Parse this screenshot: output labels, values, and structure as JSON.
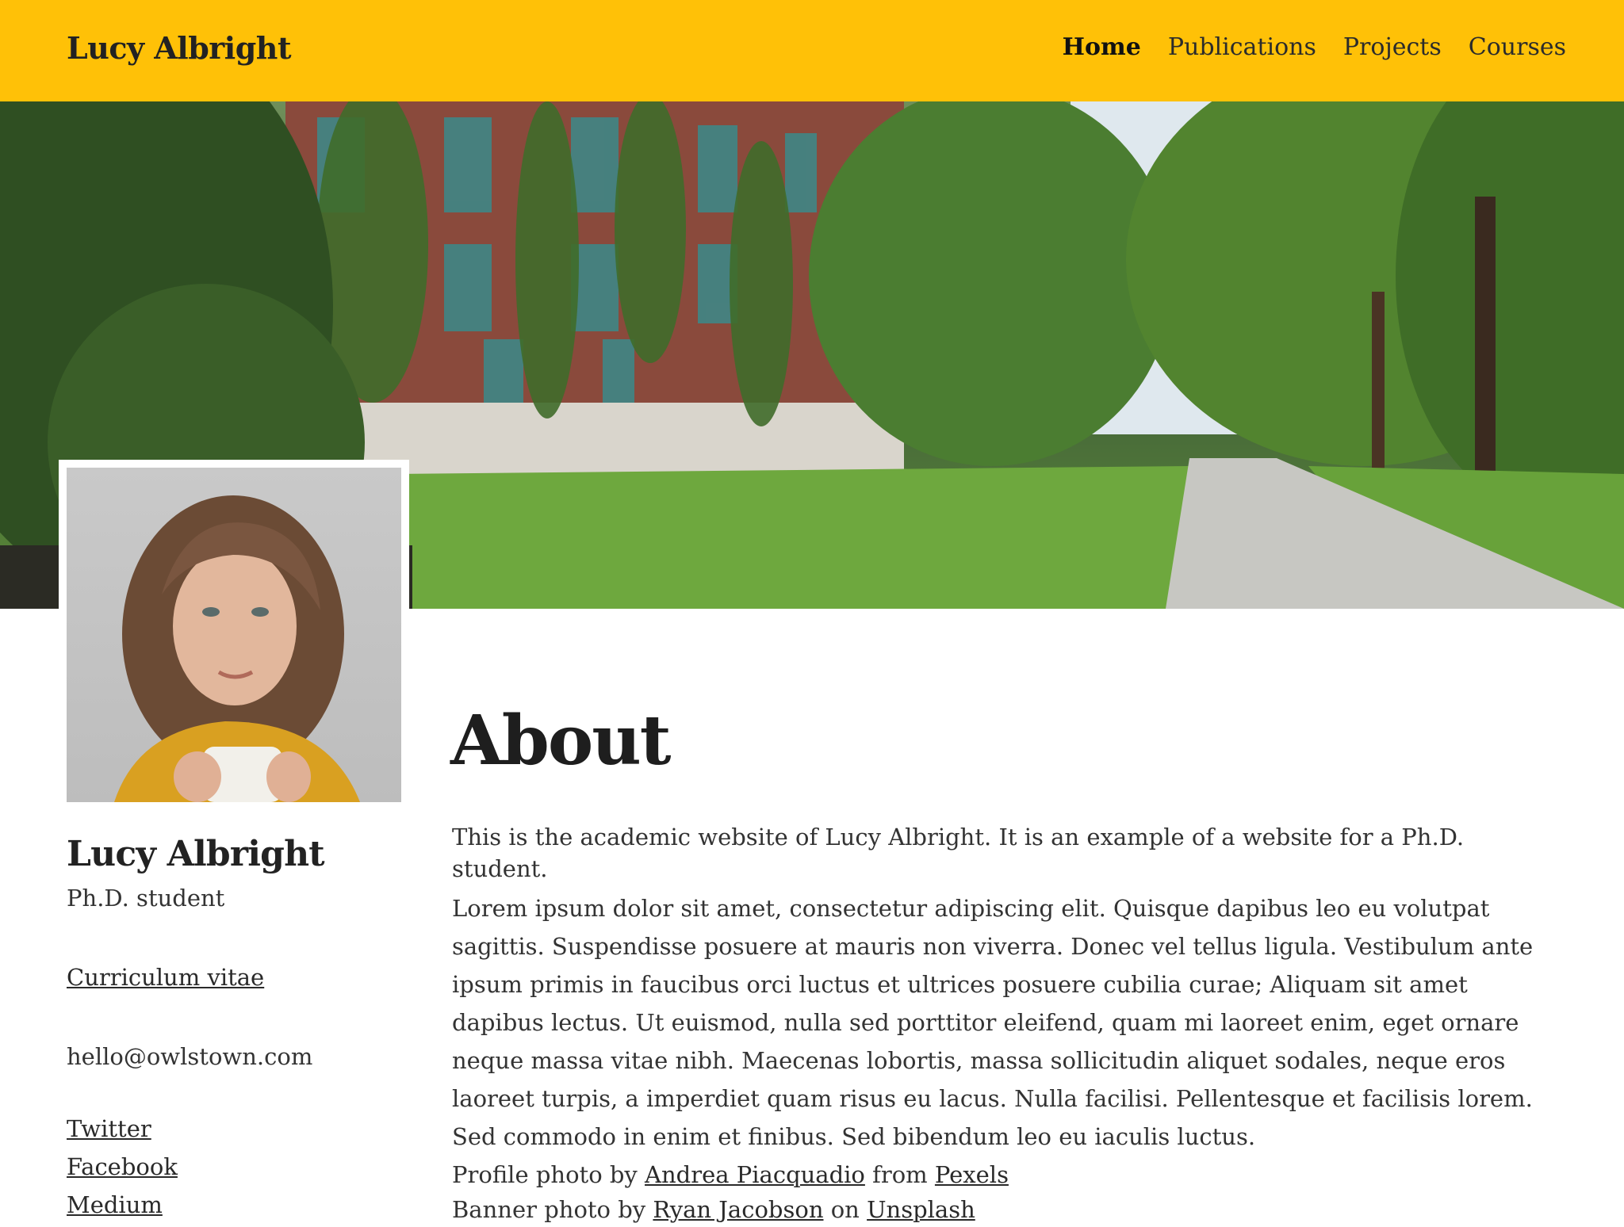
{
  "header": {
    "site_title": "Lucy Albright",
    "nav": [
      {
        "label": "Home",
        "active": true
      },
      {
        "label": "Publications",
        "active": false
      },
      {
        "label": "Projects",
        "active": false
      },
      {
        "label": "Courses",
        "active": false
      }
    ],
    "bar_color": "#ffc107"
  },
  "banner": {
    "image": "campus-building-banner"
  },
  "sidebar": {
    "photo": "profile-photo",
    "name": "Lucy Albright",
    "role": "Ph.D. student",
    "cv_link": "Curriculum vitae",
    "email": "hello@owlstown.com",
    "social_links": [
      "Twitter",
      "Facebook",
      "Medium"
    ]
  },
  "main": {
    "title": "About",
    "intro": "This is the academic website of Lucy Albright. It is an example of a website for a Ph.D. student.",
    "body": "Lorem ipsum dolor sit amet, consectetur adipiscing elit. Quisque dapibus leo eu volutpat sagittis. Suspendisse posuere at mauris non viverra. Donec vel tellus ligula. Vestibulum ante ipsum primis in faucibus orci luctus et ultrices posuere cubilia curae; Aliquam sit amet dapibus lectus. Ut euismod, nulla sed porttitor eleifend, quam mi laoreet enim, eget ornare neque massa vitae nibh. Maecenas lobortis, massa sollicitudin aliquet sodales, neque eros laoreet turpis, a imperdiet quam risus eu lacus. Nulla facilisi. Pellentesque et facilisis lorem. Sed commodo in enim et finibus. Sed bibendum leo eu iaculis luctus.",
    "credits": {
      "profile_prefix": "Profile photo by",
      "profile_author": "Andrea Piacquadio",
      "profile_from": "from",
      "profile_source": "Pexels",
      "banner_prefix": "Banner photo by",
      "banner_author": "Ryan Jacobson",
      "banner_on": "on",
      "banner_source": "Unsplash"
    }
  }
}
